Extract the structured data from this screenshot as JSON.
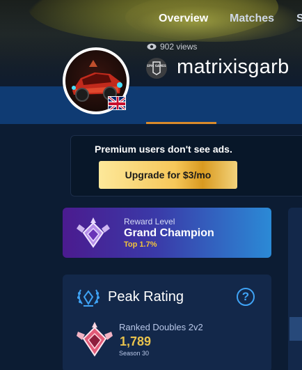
{
  "profile": {
    "views": "902 views",
    "platform_icon": "epic-games-icon",
    "platform_logo_text": "EPIC GAMES",
    "username": "matrixisgarb",
    "country_flag": "uk-flag"
  },
  "tabs": [
    {
      "label": "Overview",
      "active": true
    },
    {
      "label": "Matches",
      "active": false
    },
    {
      "label": "S",
      "active": false
    }
  ],
  "ad": {
    "message": "Premium users don't see ads.",
    "button_label": "Upgrade for $3/mo"
  },
  "reward": {
    "label": "Reward Level",
    "rank": "Grand Champion",
    "percentile": "Top 1.7%"
  },
  "peak": {
    "title": "Peak Rating",
    "help_symbol": "?",
    "playlist": "Ranked Doubles 2v2",
    "rating": "1,789",
    "season": "Season 30"
  },
  "colors": {
    "nav_bg": "#0f3b73",
    "tab_accent": "#d98a2b",
    "rating_gold": "#e8c24d",
    "help_blue": "#3fa3f5"
  }
}
